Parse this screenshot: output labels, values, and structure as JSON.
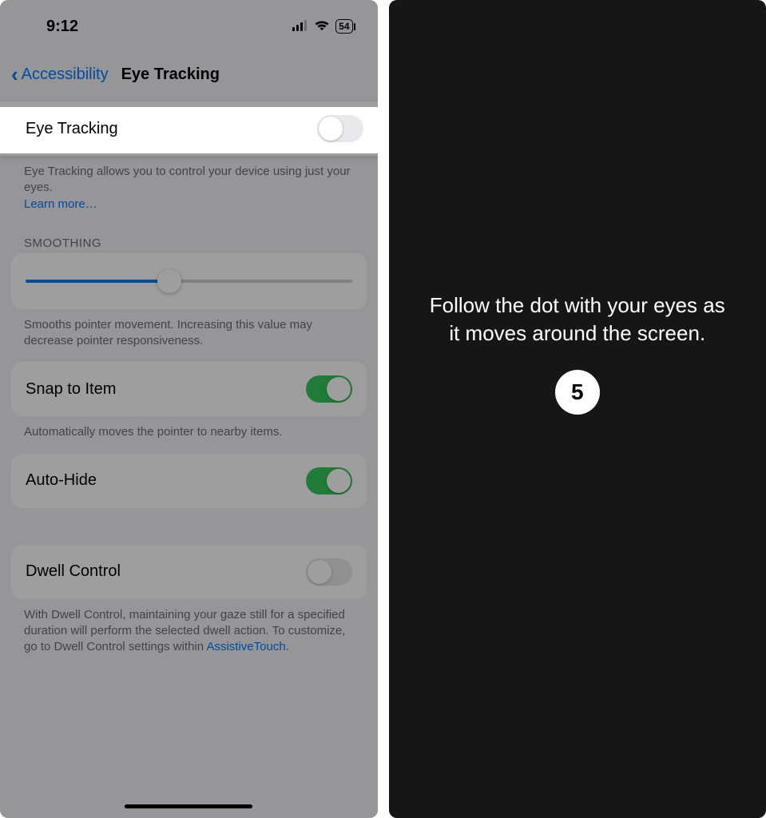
{
  "left": {
    "status": {
      "time": "9:12",
      "battery": "54"
    },
    "nav": {
      "back": "Accessibility",
      "title": "Eye Tracking"
    },
    "eye_tracking": {
      "label": "Eye Tracking",
      "footer": "Eye Tracking allows you to control your device using just your eyes.",
      "learn_more": "Learn more…"
    },
    "smoothing": {
      "header": "SMOOTHING",
      "footer": "Smooths pointer movement. Increasing this value may decrease pointer responsiveness."
    },
    "snap": {
      "label": "Snap to Item",
      "footer": "Automatically moves the pointer to nearby items."
    },
    "auto_hide": {
      "label": "Auto-Hide"
    },
    "dwell": {
      "label": "Dwell Control",
      "footer_a": "With Dwell Control, maintaining your gaze still for a specified duration will perform the selected dwell action. To customize, go to Dwell Control settings within ",
      "footer_link": "AssistiveTouch",
      "footer_b": "."
    }
  },
  "right": {
    "instruction": "Follow the dot with your eyes as it moves around the screen.",
    "countdown": "5"
  }
}
